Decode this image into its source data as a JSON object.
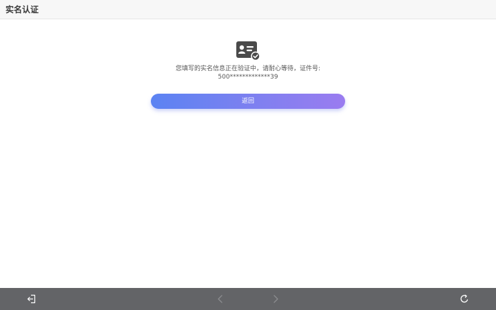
{
  "header": {
    "title": "实名认证"
  },
  "main": {
    "icon": "id-card-check-icon",
    "message": "您填写的实名信息正在验证中，请耐心等待，证件号:",
    "id_number": "500*************39",
    "back_label": "返回",
    "accent_colors": [
      "#5b83f2",
      "#9a7cf0"
    ]
  },
  "bottom_bar": {
    "background": "#636467",
    "icons": [
      "exit-icon",
      "chevron-left-icon",
      "chevron-right-icon",
      "refresh-icon"
    ]
  }
}
